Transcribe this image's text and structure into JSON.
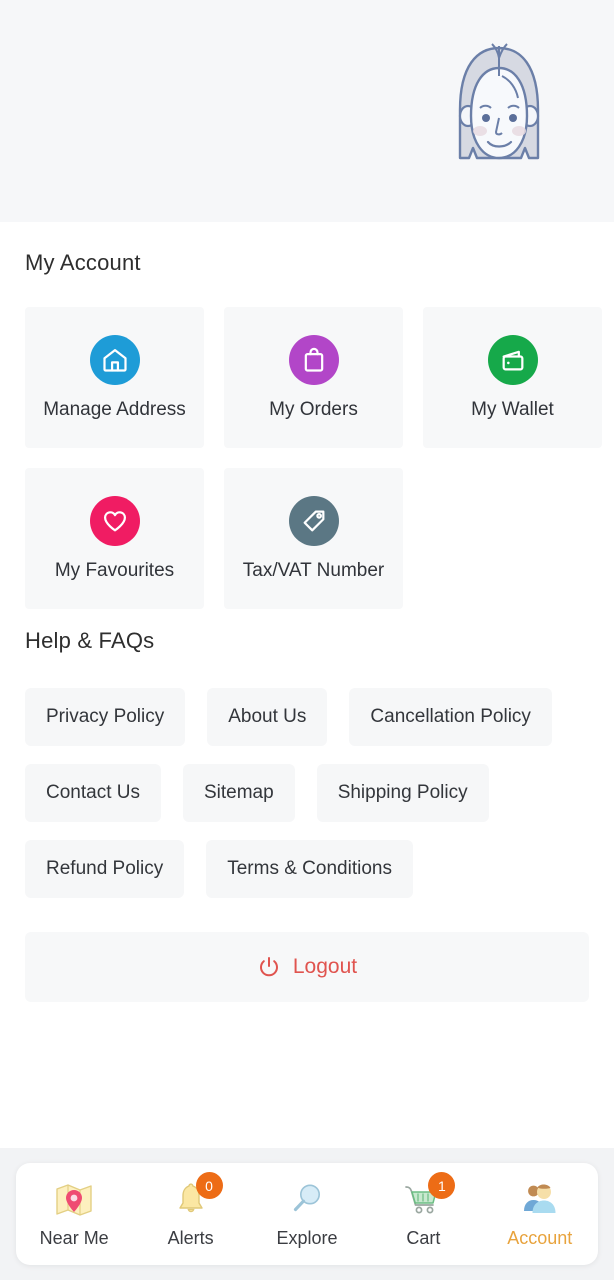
{
  "header": {
    "avatar_icon": "user-avatar-female-illustration",
    "background_color": "#f6f7f9"
  },
  "account_section": {
    "title": "My Account",
    "cards": [
      {
        "label": "Manage Address",
        "icon": "home-icon",
        "color": "#1e9cd7"
      },
      {
        "label": "My Orders",
        "icon": "shopping-bag-icon",
        "color": "#b246c8"
      },
      {
        "label": "My Wallet",
        "icon": "wallet-icon",
        "color": "#16a94a"
      },
      {
        "label": "My Favourites",
        "icon": "heart-icon",
        "color": "#f01c63"
      },
      {
        "label": "Tax/VAT Number",
        "icon": "price-tag-icon",
        "color": "#5b7784"
      }
    ]
  },
  "help_section": {
    "title": "Help & FAQs",
    "chips": [
      {
        "label": "Privacy Policy"
      },
      {
        "label": "About Us"
      },
      {
        "label": "Cancellation Policy"
      },
      {
        "label": "Contact Us"
      },
      {
        "label": "Sitemap"
      },
      {
        "label": "Shipping Policy"
      },
      {
        "label": "Refund Policy"
      },
      {
        "label": "Terms & Conditions"
      }
    ]
  },
  "logout": {
    "label": "Logout",
    "icon": "power-icon",
    "color": "#e0544f"
  },
  "bottom_nav": {
    "active_color": "#e8a33d",
    "badge_color": "#ed6c16",
    "items": [
      {
        "label": "Near Me",
        "icon": "map-pin-icon",
        "badge": null,
        "active": false
      },
      {
        "label": "Alerts",
        "icon": "bell-icon",
        "badge": "0",
        "active": false
      },
      {
        "label": "Explore",
        "icon": "magnifier-icon",
        "badge": null,
        "active": false
      },
      {
        "label": "Cart",
        "icon": "shopping-cart-icon",
        "badge": "1",
        "active": false
      },
      {
        "label": "Account",
        "icon": "users-icon",
        "badge": null,
        "active": true
      }
    ]
  }
}
